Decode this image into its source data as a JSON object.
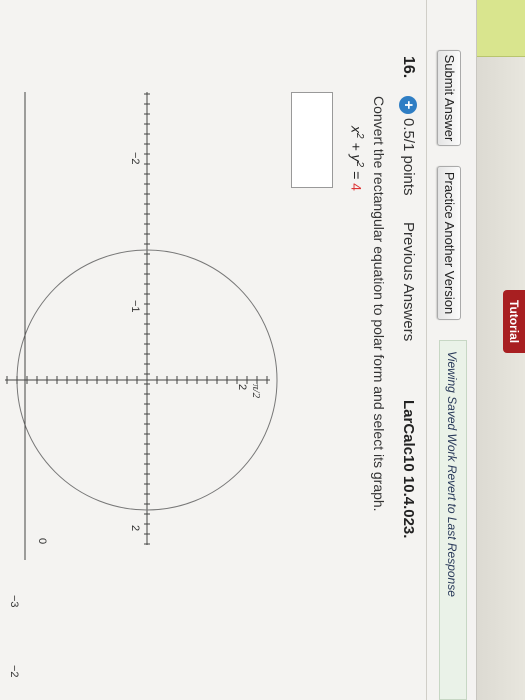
{
  "toolbar": {
    "header_label": "Tutorial",
    "submit_label": "Submit Answer",
    "practice_label": "Practice Another Version",
    "saved_text": "Viewing Saved Work Revert to Last Response"
  },
  "question": {
    "number": "16.",
    "points_icon": "+",
    "points": "0.5/1 points",
    "previous_answers": "Previous Answers",
    "course_code": "LarCalc10 10.4.023.",
    "instruction": "Convert the rectangular equation to polar form and select its graph.",
    "equation_lhs_x": "x",
    "equation_exp1": "2",
    "equation_plus": " + y",
    "equation_exp2": "2",
    "equation_eq": " = ",
    "equation_rhs": "4"
  },
  "graph": {
    "label_pi_half": "π/2",
    "tick_labels": [
      {
        "text": "2",
        "axis": "vertical-top"
      },
      {
        "text": "−1",
        "axis": "horizontal-left"
      },
      {
        "text": "−2",
        "axis": "horizontal-far-left"
      },
      {
        "text": "2",
        "axis": "horizontal-right"
      },
      {
        "text": "0",
        "axis": "horizontal-zero"
      },
      {
        "text": "−3",
        "axis": "second-graph-left"
      },
      {
        "text": "−2",
        "axis": "second-graph-right"
      }
    ]
  },
  "colors": {
    "equation_rhs": "#dd3333",
    "points_icon": "#2f7ec4",
    "saved_bar": "#eaf2e8"
  }
}
